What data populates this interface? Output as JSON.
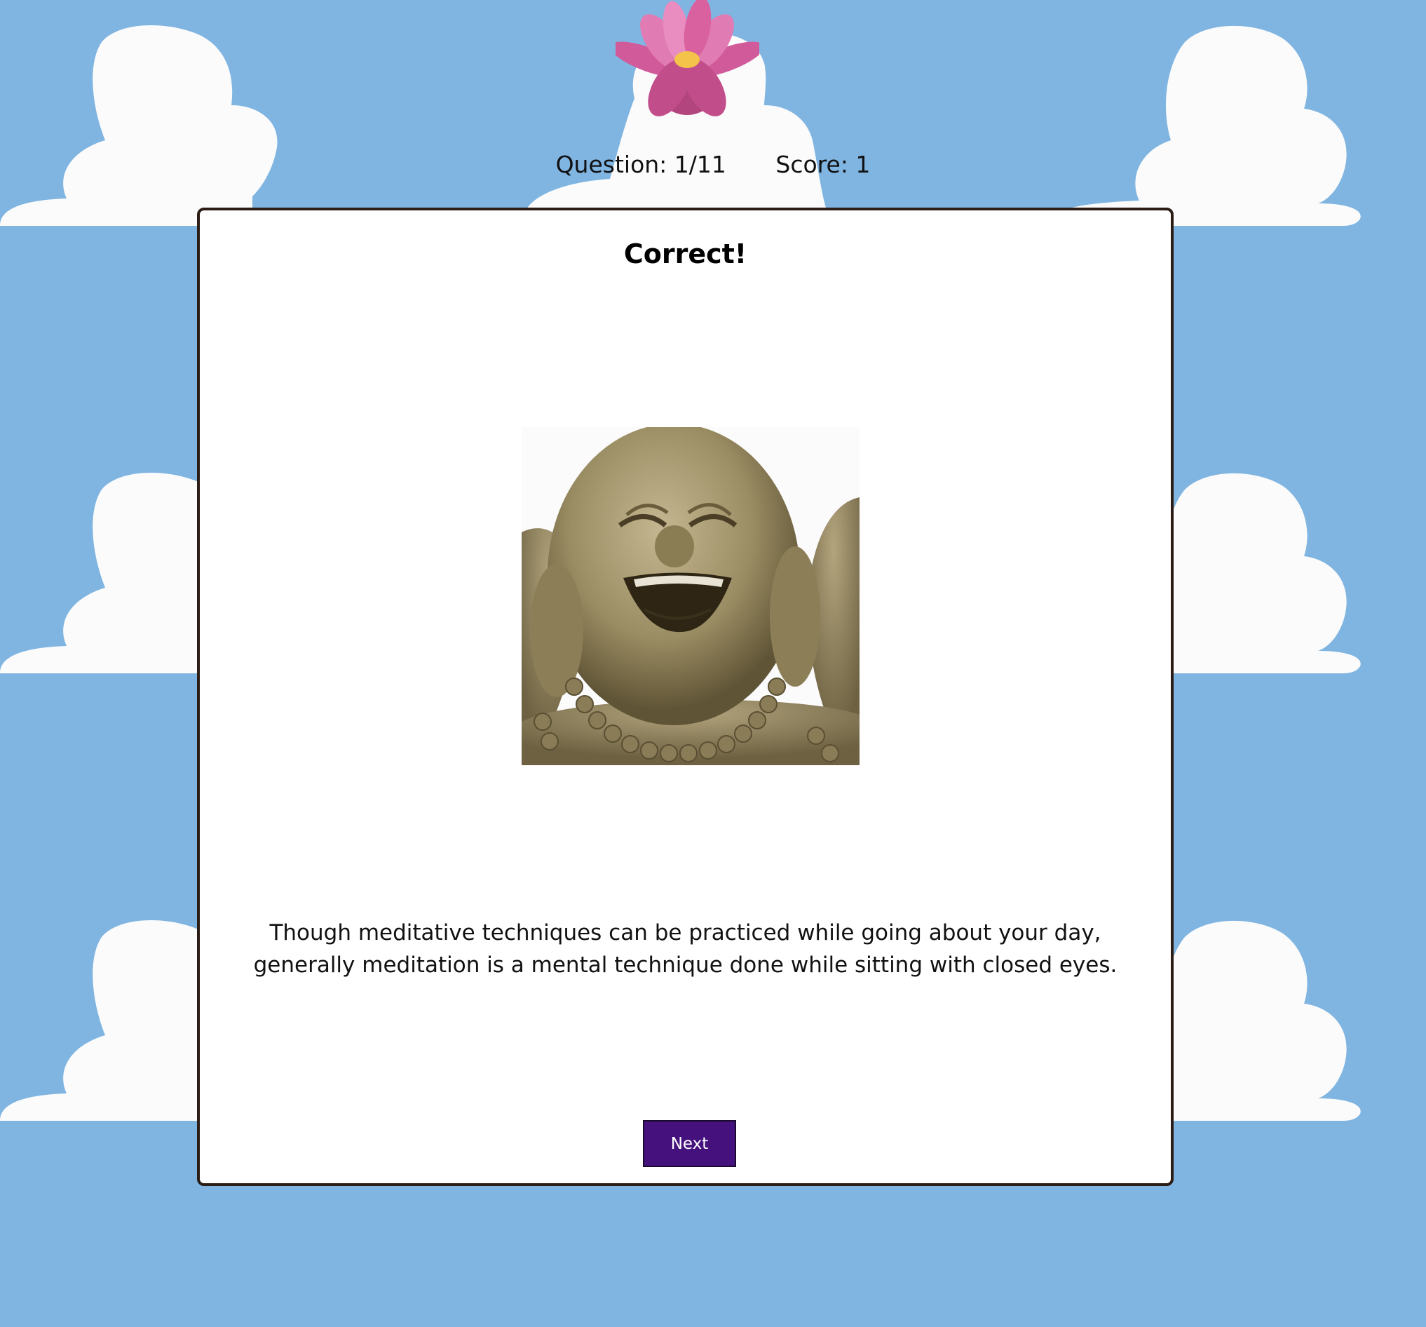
{
  "status": {
    "question_label": "Question: 1/11",
    "score_label": "Score: 1"
  },
  "result": {
    "title": "Correct!",
    "image": "laughing-buddha-statue",
    "explanation": "Though meditative techniques can be practiced while going about your day, generally meditation is a mental technique done while sitting with closed eyes."
  },
  "actions": {
    "next_label": "Next"
  },
  "colors": {
    "background": "#80b5e2",
    "cloud": "#fbfbfb",
    "card_border": "#2b1d16",
    "button": "#45127d"
  }
}
